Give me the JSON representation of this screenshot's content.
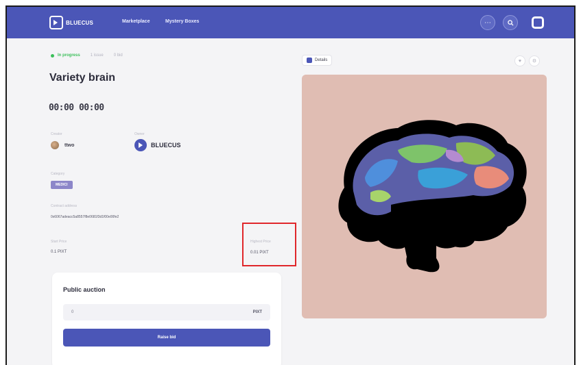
{
  "header": {
    "logo_text": "BLUECUS",
    "nav": [
      "Marketplace",
      "Mystery Boxes"
    ],
    "icons": {
      "more": "more-icon",
      "search": "search-icon",
      "user": "user-logo-icon"
    },
    "colors": {
      "bar": "#4b56b7"
    }
  },
  "item": {
    "status": "In progress",
    "status_meta": [
      "1 issue",
      "0 bid"
    ],
    "title": "Variety brain",
    "timer": "00:00 00:00",
    "creator_label": "Creator",
    "creator_name": "ttwo",
    "owner_label": "Owner",
    "owner_name": "BLUECUS",
    "category_label": "Category",
    "category_value": "MEDICI",
    "contract_label": "Contract address",
    "contract_value": "0x6067adeacc5a8557f8e0681f3d1f00e00fe2",
    "start_price_label": "Start Price",
    "start_price_value": "0.1 PIXT",
    "highest_price_label": "Highest Price",
    "highest_price_value": "0.01 PIXT"
  },
  "auction": {
    "title": "Public auction",
    "bid_value": "0",
    "bid_unit": "PIXT",
    "raise_button": "Raise bid"
  },
  "media": {
    "details_label": "Details",
    "icons": {
      "heart": "heart-icon",
      "share": "share-icon"
    }
  },
  "annotation": {
    "highlight_color": "#e0262a"
  }
}
